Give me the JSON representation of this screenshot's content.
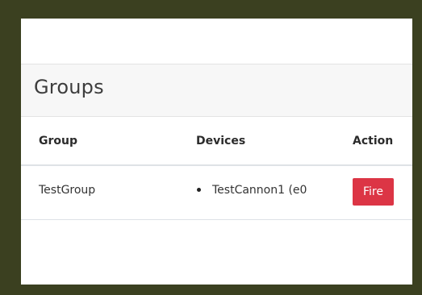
{
  "card": {
    "title": "Groups"
  },
  "table": {
    "headers": {
      "group": "Group",
      "devices": "Devices",
      "action": "Action"
    },
    "rows": [
      {
        "group": "TestGroup",
        "devices": [
          "TestCannon1 (e0"
        ],
        "action_label": "Fire"
      }
    ]
  },
  "colors": {
    "frame": "#3b4020",
    "danger": "#dc3545",
    "header_bg": "#f7f7f7"
  }
}
